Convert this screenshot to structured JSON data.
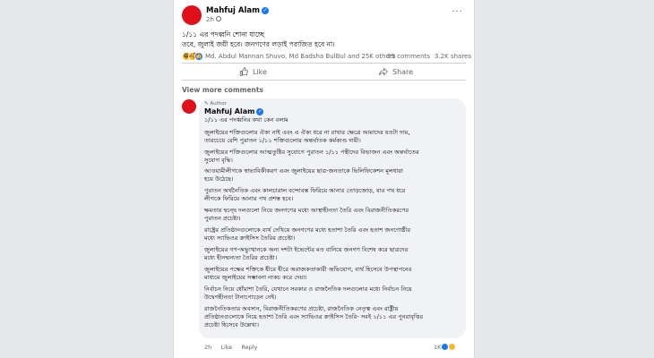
{
  "post": {
    "author": "Mahfuj Alam",
    "time": "2h",
    "more": "···",
    "text_line1": "১/১১ এর পদধ্বনি শোনা যাচ্ছে",
    "text_line2": "তবে, জুলাই জয়ী হবে। জনগণের লড়াই পরাজিত হবে না।",
    "reactors": "Md. Abdul Mannan Shuvo, Md Badsha BulBul and 25K others",
    "comments": "29 comments",
    "shares": "3.2K shares",
    "like_label": "Like",
    "share_label": "Share",
    "reaction_icons": [
      "haha-icon",
      "care-icon",
      "like-icon"
    ]
  },
  "view_more_comments": "View more comments",
  "comment": {
    "badge": "Author",
    "author": "Mahfuj Alam",
    "lines": [
      "১/১১ এর পদধ্বনির কথা কেন বলাম",
      "জুলাইয়ের শক্তিগুলোর ঐক্য নাই এবং এ ঐক্য ধরে না রাখার ক্ষেত্রে আমাদের যতটা দায়,",
      "তারচেয়ে বেশি পুরাতন ১/১১ শক্তিগুলোর অন্তর্ঘাতক কর্মকাণ্ড দায়ী।",
      "জুলাইয়ের শক্তিগুলোর আত্মতুষ্টির সুযোগে পুরাতন ১/১১ পন্থীদের বিভাজন এবং অন্তর্ঘাতের",
      "সুযোগ বৃদ্ধি।",
      "আওয়ামীলীগকে স্বাভাবিকীকরণ এবং জুলাইয়ের ছাত্র-জনতাকে ভিলিফিকেশন মূলধারা",
      "হয়ে উঠেছে।",
      "পুরাতন অর্থনৈতিক এবং কালচারাল বন্দোবস্ত ফিরিয়ে আনার তোড়জোড়, যার পথ ধরে",
      "লীগকে ফিরিয়ে আনার পথ প্রশস্ত হবে।",
      "ক্ষমতার দ্বন্দ্বে দলগুলো নিয়ে জনগণের মধ্যে আস্থাহীনতা তৈরি এবং বিরাজনীতিকরণের",
      "পুরাতন প্রচেষ্টা।",
      "রাষ্ট্রের প্রতিষ্ঠানগুলোকে ব্যর্থ দেখিয়ে জনগণের মধ্যে হতাশা তৈরি এবং হতাশ জনগোষ্ঠীর",
      "মধ্যে স্যাভিওর ক্রাইসিস তৈরির প্রচেষ্টা।",
      "জুলাইয়ের গণ-অভ্যুত্থানকে অন্য দশটা ইভেন্টের মত বানিয়ে জনগণ বিশেষ করে ছাত্রদের",
      "মধ্যে হীনম্মন্যতা তৈরির প্রচেষ্টা।",
      "জুলাইয়ের পক্ষের শক্তিকে ধীরে ধীরে অরাজকতাকারী অভিযোগ, ব্যর্থ হিসেবে উপস্থাপনের",
      "মাধ্যমে জুলাইয়ের সম্ভাবনা নাকচ করে দেয়া।",
      "নির্বাচন নিয়ে ধোঁয়াশা তৈরি, যেখানে সরকার ও রাজনৈতিক দলগুলোর মধ্যে নির্বাচন নিয়ে",
      "উদ্বেগহীনতা টানাপোড়েন নেই।",
      "রাজনৈতিকতার অবসান, বিরাজনীতিকরণের প্রচেষ্টা, রাজনৈতিক নেতৃত্ব এবং রাষ্ট্রীয়",
      "প্রতিষ্ঠানগুলোকে নিয়ে হতাশা তৈরি এবং স্যাভিওর ক্রাইসিস তৈরি- সবই ১/১১ এর পুনরাবৃত্তির",
      "প্রচেষ্টা হিসেবে উল্লেখ্য।"
    ],
    "time": "2h",
    "like": "Like",
    "reply": "Reply",
    "reaction_count": "1K"
  }
}
